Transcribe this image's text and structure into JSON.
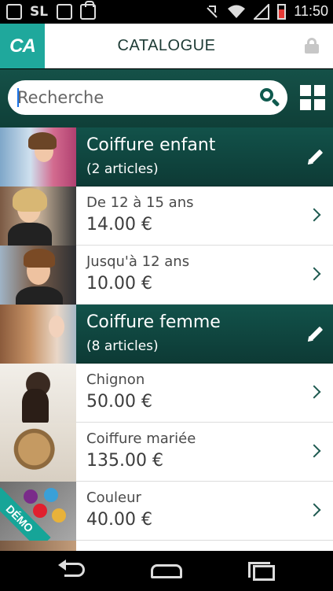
{
  "status_bar": {
    "time": "11:50",
    "left_icons": [
      "image-icon",
      "sl-icon",
      "face-icon",
      "bag-icon"
    ],
    "right_icons": [
      "mute-icon",
      "wifi-icon",
      "signal-icon",
      "battery-icon"
    ],
    "battery_level": 0.7
  },
  "header": {
    "logo_text": "CA",
    "title": "CATALOGUE",
    "lock_icon": "lock-icon"
  },
  "search": {
    "placeholder": "Recherche",
    "value": "",
    "search_icon": "search-icon",
    "grid_icon": "grid-view-icon"
  },
  "catalog": [
    {
      "type": "category",
      "name": "Coiffure enfant",
      "count": "(2 articles)",
      "icon": "edit-pencil-icon"
    },
    {
      "type": "item",
      "name": "De 12 à 15 ans",
      "price": "14.00 €"
    },
    {
      "type": "item",
      "name": "Jusqu'à 12 ans",
      "price": "10.00 €"
    },
    {
      "type": "category",
      "name": "Coiffure femme",
      "count": "(8 articles)",
      "icon": "edit-pencil-icon"
    },
    {
      "type": "item",
      "name": "Chignon",
      "price": "50.00 €"
    },
    {
      "type": "item",
      "name": "Coiffure mariée",
      "price": "135.00 €"
    },
    {
      "type": "item",
      "name": "Couleur",
      "price": "40.00 €",
      "badge": "DÉMO"
    }
  ],
  "colors": {
    "brand_teal": "#1fa89c",
    "dark_green": "#12524a",
    "accent_green": "#0f5a4e"
  },
  "nav": {
    "back_icon": "back-icon",
    "home_icon": "home-icon",
    "recents_icon": "recents-icon"
  }
}
